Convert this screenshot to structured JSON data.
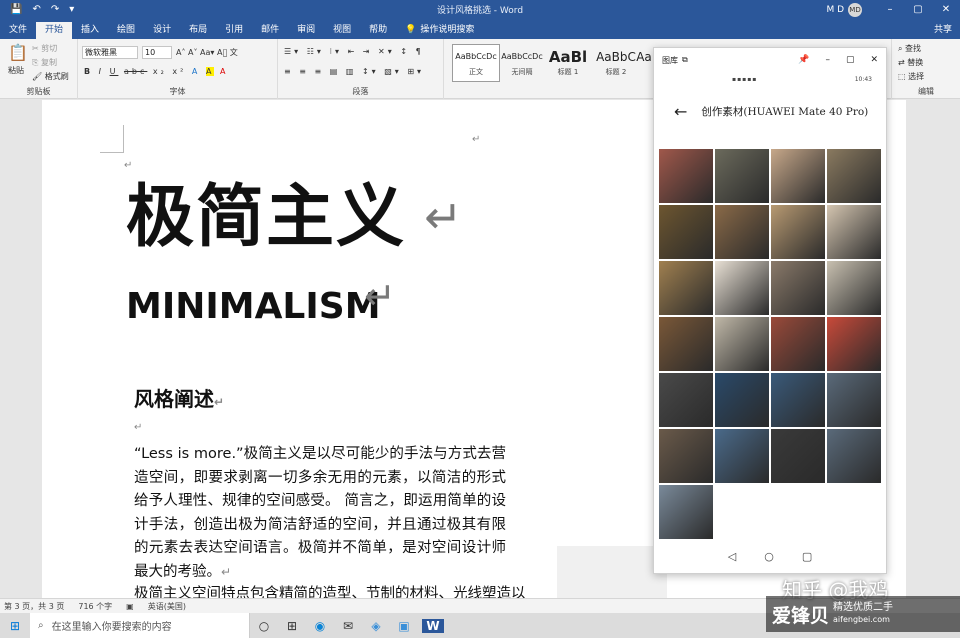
{
  "window": {
    "title": "设计风格挑选 - Word",
    "user": "M D",
    "avatar": "MD",
    "controls": [
      "–",
      "▢",
      "✕"
    ]
  },
  "qat": [
    "💾",
    "↶",
    "↷",
    "▾"
  ],
  "tabs": [
    "文件",
    "开始",
    "插入",
    "绘图",
    "设计",
    "布局",
    "引用",
    "邮件",
    "审阅",
    "视图",
    "帮助"
  ],
  "tell_me": "操作说明搜索",
  "share": "共享",
  "ribbon": {
    "clipboard": {
      "paste": "粘贴",
      "cut": "剪切",
      "copy": "复制",
      "format_painter": "格式刷",
      "label": "剪贴板"
    },
    "font": {
      "name": "微软雅黑",
      "size": "10",
      "label": "字体",
      "row2": [
        "B",
        "I",
        "U",
        "abc",
        "x₂",
        "x²",
        "A",
        "A",
        "A"
      ]
    },
    "paragraph": {
      "label": "段落"
    },
    "styles": [
      {
        "preview": "AaBbCcDc",
        "name": "正文"
      },
      {
        "preview": "AaBbCcDc",
        "name": "无间隔"
      },
      {
        "preview": "AaBl",
        "name": "标题 1"
      },
      {
        "preview": "AaBbC",
        "name": "标题 2"
      },
      {
        "preview": "Aa",
        "name": ""
      }
    ],
    "editing": {
      "find": "查找",
      "replace": "替换",
      "select": "选择",
      "label": "编辑"
    }
  },
  "document": {
    "title": "极简主义",
    "subtitle": "MINIMALISM",
    "section": "风格阐述",
    "return_mark": "↵",
    "paragraph1": "“Less is more.”极简主义是以尽可能少的手法与方式去营造空间，即要求剥离一切多余无用的元素，以简洁的形式给予人理性、规律的空间感受。 简言之，即运用简单的设计手法，创造出极为简洁舒适的空间，并且通过极其有限的元素去表达空间语言。极简并不简单，是对空间设计师最大的考验。",
    "paragraph2": "极简主义空间特点包含精简的造型、节制的材料、光线塑造以"
  },
  "gallery": {
    "window_title": "图库",
    "status_right": "10:43",
    "back": "←",
    "album": "创作素材(HUAWEI Mate 40 Pro)",
    "thumbnails": [
      "#a0584b",
      "#6b6a5c",
      "#c7a88a",
      "#8a7a60",
      "#6d5630",
      "#8a6a48",
      "#b89a72",
      "#d4c5b0",
      "#a08050",
      "#e8e0d4",
      "#8a7a6a",
      "#c8c0b0",
      "#7a5838",
      "#c0b8a8",
      "#9a4a3a",
      "#c84a3a",
      "#4a4a4a",
      "#2a4a6a",
      "#3a5a7a",
      "#5a6a7a",
      "#6a5a4a",
      "#4a6a8a",
      "#3a3a3a",
      "#5a6a7a",
      "#7a8a9a"
    ],
    "nav": [
      "◁",
      "○",
      "▢"
    ]
  },
  "statusbar": [
    "第 3 页，共 3 页",
    "716 个字",
    "英语(美国)"
  ],
  "taskbar": {
    "search": "在这里输入你要搜索的内容",
    "icons": [
      "○",
      "⊞",
      "◉",
      "✉",
      "◈",
      "▣",
      "W"
    ]
  },
  "watermarks": {
    "zhihu": "知乎 @我鸡",
    "brand": "爱锋贝",
    "slogan": "精选优质二手",
    "url": "aifengbei.com"
  }
}
